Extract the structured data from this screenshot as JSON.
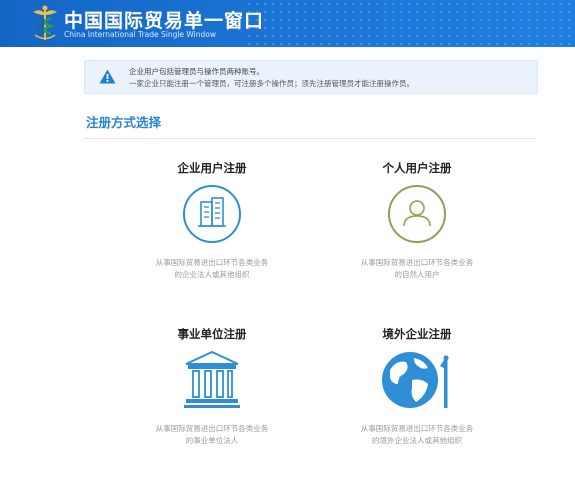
{
  "header": {
    "title": "中国国际贸易单一窗口",
    "subtitle": "China International Trade Single Window"
  },
  "notice": {
    "line1": "企业用户包括管理员与操作员两种账号。",
    "line2": "一家企业只能注册一个管理员，可注册多个操作员；须先注册管理员才能注册操作员。"
  },
  "section": {
    "title": "注册方式选择"
  },
  "cards": [
    {
      "title": "企业用户注册",
      "desc1": "从事国际贸易进出口环节各类业务",
      "desc2": "的企业法人或其他组织",
      "icon": "building-icon",
      "color": "#2e8fd6"
    },
    {
      "title": "个人用户注册",
      "desc1": "从事国际贸易进出口环节各类业务",
      "desc2": "的自然人用户",
      "icon": "person-icon",
      "color": "#9a9a58"
    },
    {
      "title": "事业单位注册",
      "desc1": "从事国际贸易进出口环节各类业务",
      "desc2": "的事业单位法人",
      "icon": "institution-icon",
      "color": "#2e8fd6"
    },
    {
      "title": "境外企业注册",
      "desc1": "从事国际贸易进出口环节各类业务",
      "desc2": "的境外企业法人或其他组织",
      "icon": "globe-icon",
      "color": "#2e8fd6"
    }
  ]
}
